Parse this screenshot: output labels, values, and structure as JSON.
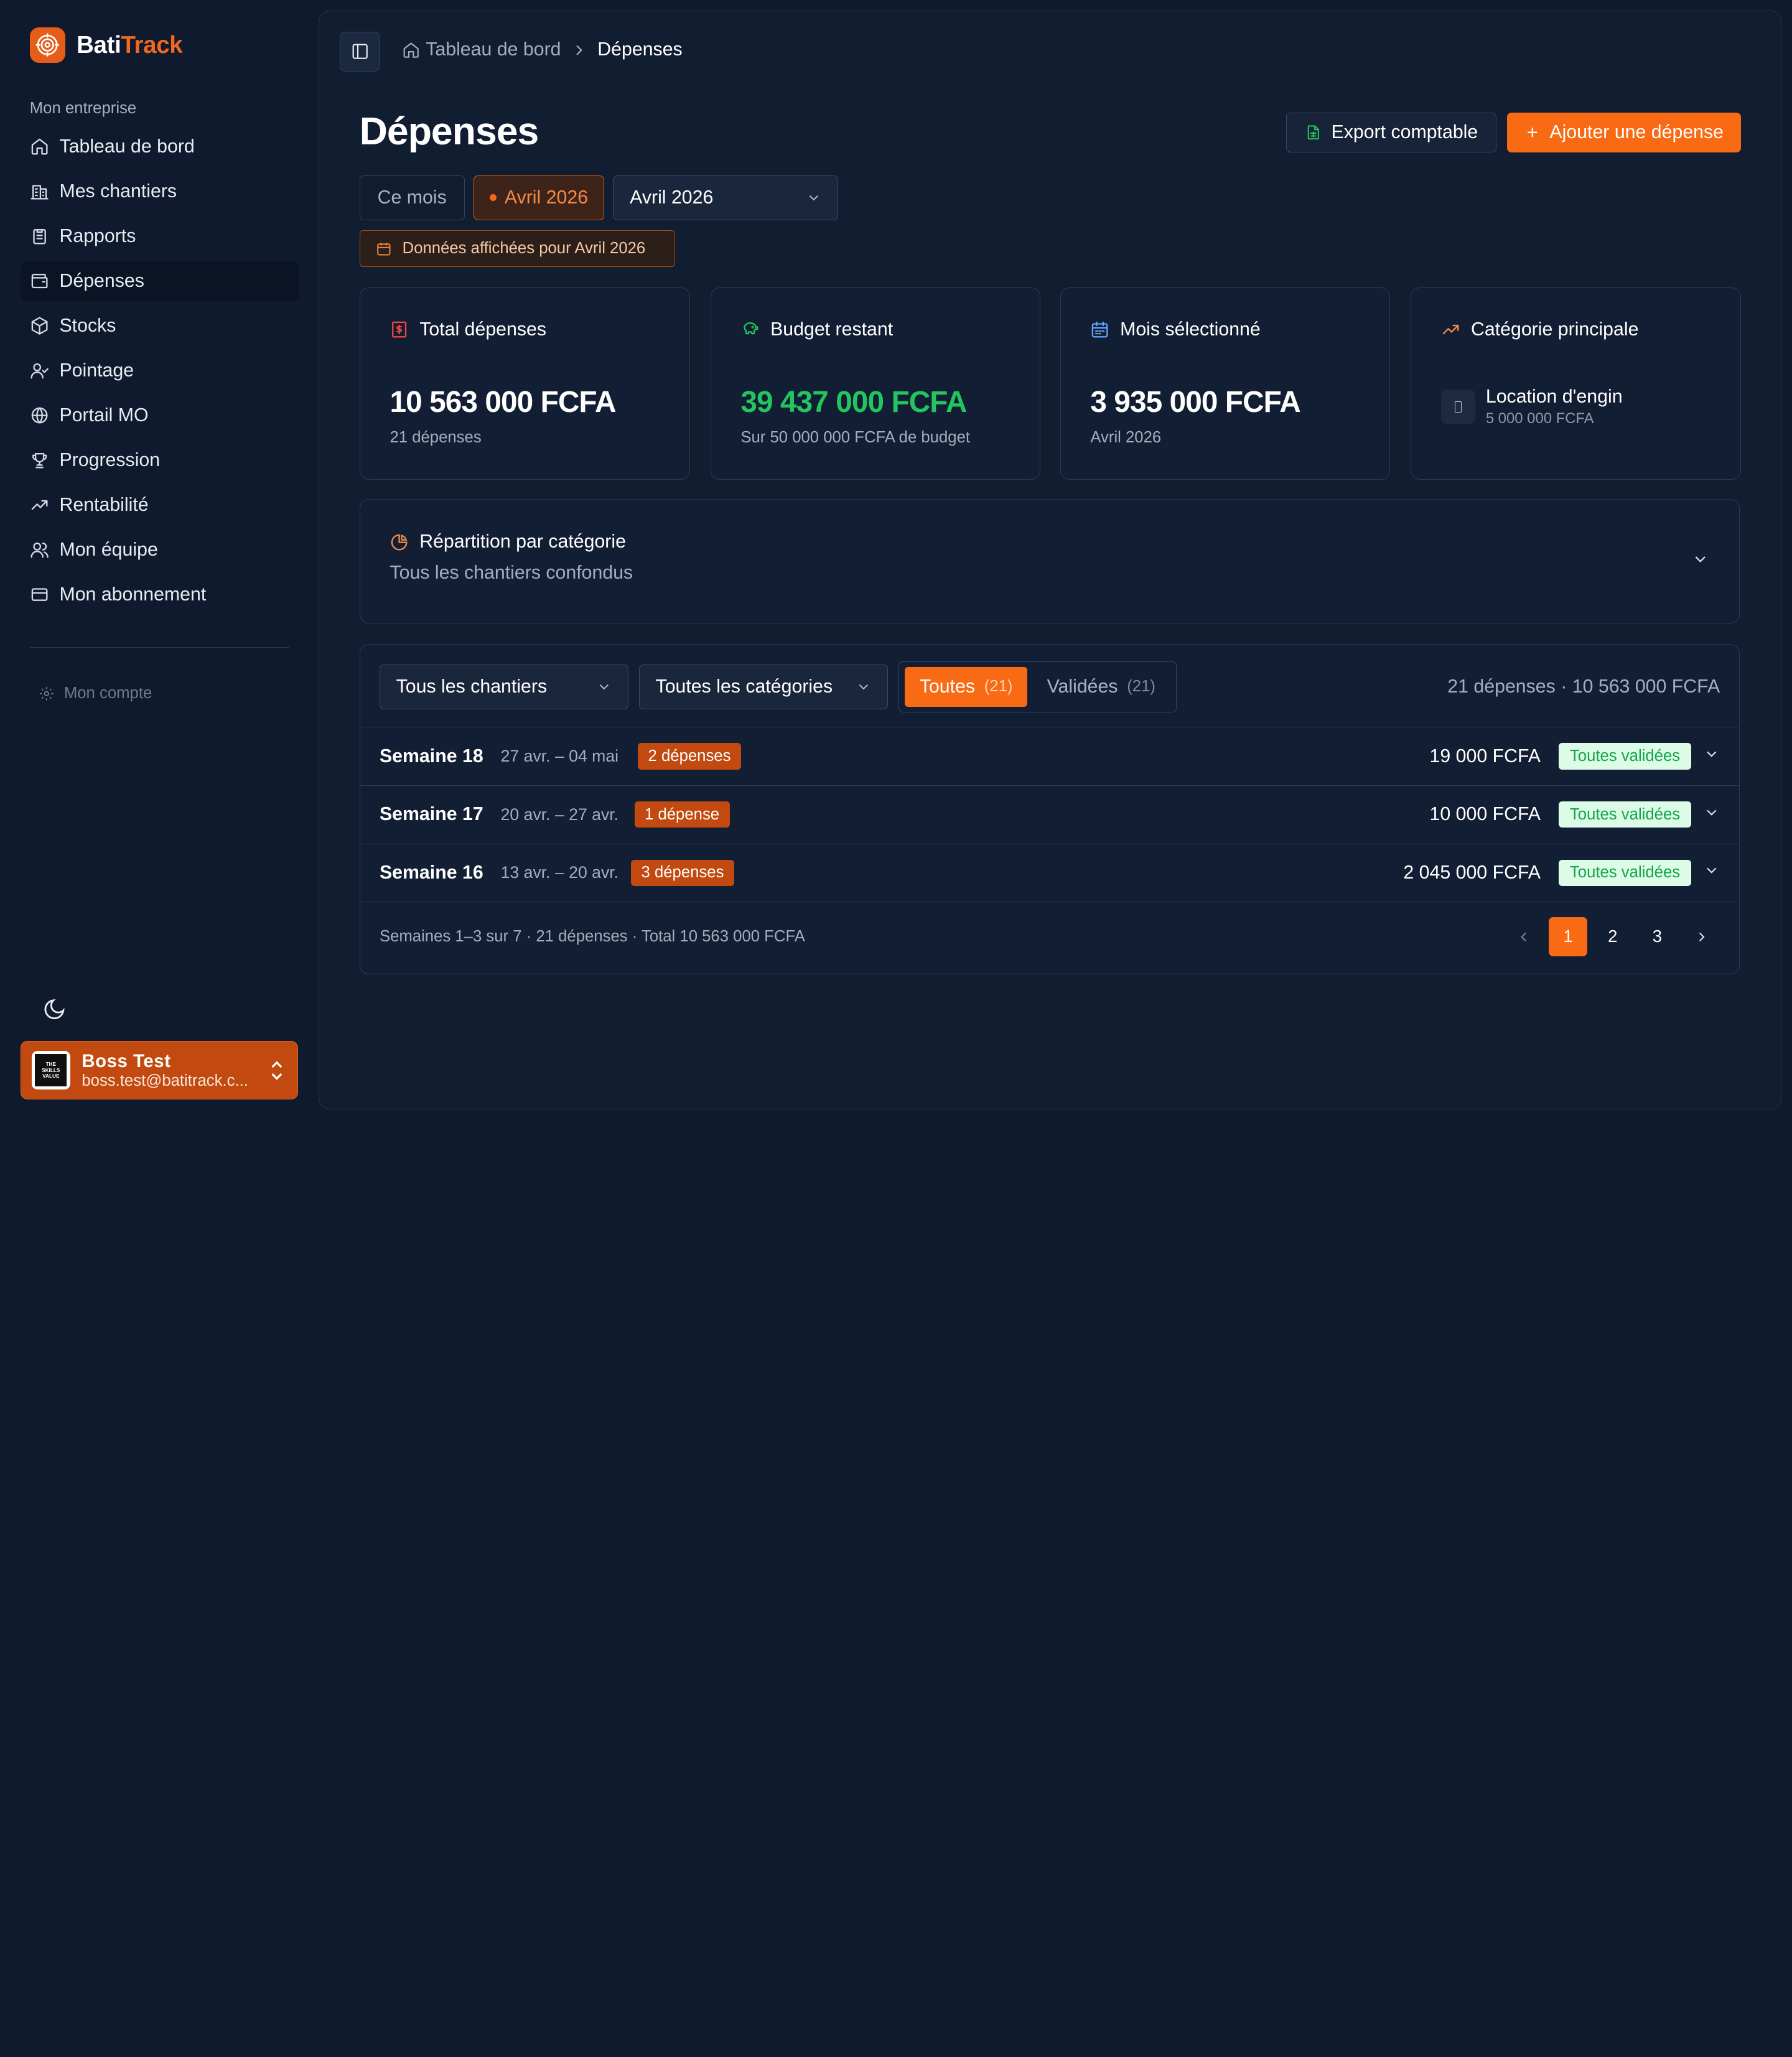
{
  "brand": {
    "name_part1": "Bati",
    "name_part2": "Track",
    "accent": "#f96a14"
  },
  "sidebar": {
    "section_label": "Mon entreprise",
    "items": [
      {
        "label": "Tableau de bord",
        "icon": "home-icon"
      },
      {
        "label": "Mes chantiers",
        "icon": "building-icon"
      },
      {
        "label": "Rapports",
        "icon": "clipboard-icon"
      },
      {
        "label": "Dépenses",
        "icon": "wallet-icon",
        "active": true
      },
      {
        "label": "Stocks",
        "icon": "package-icon"
      },
      {
        "label": "Pointage",
        "icon": "user-check-icon"
      },
      {
        "label": "Portail MO",
        "icon": "globe-icon"
      },
      {
        "label": "Progression",
        "icon": "trophy-icon"
      },
      {
        "label": "Rentabilité",
        "icon": "trending-up-icon"
      },
      {
        "label": "Mon équipe",
        "icon": "users-icon"
      },
      {
        "label": "Mon abonnement",
        "icon": "credit-card-icon"
      }
    ],
    "account_label": "Mon compte",
    "user": {
      "name": "Boss Test",
      "email": "boss.test@batitrack.c...",
      "avatar_text": [
        "THE",
        "SKILLS",
        "VALUE"
      ]
    }
  },
  "breadcrumb": {
    "home": "Tableau de bord",
    "current": "Dépenses"
  },
  "page": {
    "title": "Dépenses",
    "export_label": "Export comptable",
    "add_label": "Ajouter une dépense"
  },
  "period": {
    "this_month": "Ce mois",
    "active_chip": "Avril 2026",
    "select_value": "Avril 2026",
    "note": "Données affichées pour Avril 2026"
  },
  "cards": {
    "total": {
      "label": "Total dépenses",
      "value": "10 563 000 FCFA",
      "sub": "21 dépenses"
    },
    "budget": {
      "label": "Budget restant",
      "value": "39 437 000 FCFA",
      "sub": "Sur 50 000 000 FCFA de budget"
    },
    "month": {
      "label": "Mois sélectionné",
      "value": "3 935 000 FCFA",
      "sub": "Avril 2026"
    },
    "category": {
      "label": "Catégorie principale",
      "name": "Location d'engin",
      "amount": "5 000 000 FCFA"
    }
  },
  "repartition": {
    "title": "Répartition par catégorie",
    "sub": "Tous les chantiers confondus"
  },
  "filters": {
    "sites": "Tous les chantiers",
    "categories": "Toutes les catégories",
    "all_label": "Toutes",
    "all_count": "(21)",
    "validated_label": "Validées",
    "validated_count": "(21)",
    "summary": "21 dépenses · 10 563 000 FCFA"
  },
  "weeks": [
    {
      "title": "Semaine 18",
      "dates": "27 avr. – 04 mai",
      "badge": "2 dépenses",
      "amount": "19 000 FCFA",
      "status": "Toutes validées"
    },
    {
      "title": "Semaine 17",
      "dates": "20 avr. – 27 avr.",
      "badge": "1 dépense",
      "amount": "10 000 FCFA",
      "status": "Toutes validées"
    },
    {
      "title": "Semaine 16",
      "dates": "13 avr. – 20 avr.",
      "badge": "3 dépenses",
      "amount": "2 045 000 FCFA",
      "status": "Toutes validées"
    }
  ],
  "footer": {
    "info": "Semaines 1–3 sur 7 · 21 dépenses · Total 10 563 000 FCFA",
    "pages": [
      "1",
      "2",
      "3"
    ],
    "current_page": "1"
  }
}
